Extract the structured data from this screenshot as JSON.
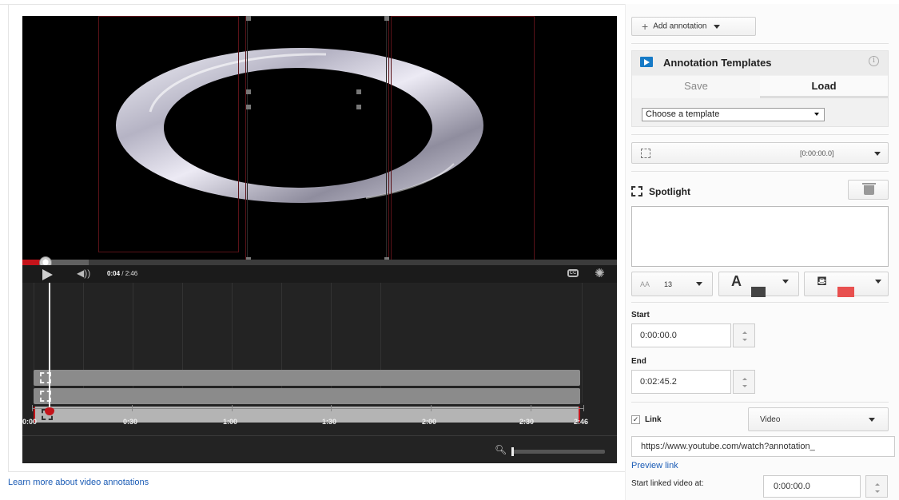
{
  "player": {
    "current_time": "0:04",
    "time_sep": " / ",
    "duration": "2:46",
    "cc_label": "CC",
    "icons": [
      "play-icon",
      "volume-icon",
      "cc-icon",
      "gear-icon",
      "zoom-icon"
    ],
    "progress_fraction": 0.024
  },
  "timeline": {
    "tick_labels": [
      "0:00",
      "0:30",
      "1:00",
      "1:30",
      "2:00",
      "2:30",
      "2:46"
    ],
    "tracks": 3,
    "selected_track": 2
  },
  "learn_more": "Learn more about video annotations",
  "sidebar": {
    "add_annotation": "Add annotation",
    "templates": {
      "title": "Annotation Templates",
      "info_glyph": "i",
      "tab_save": "Save",
      "tab_load": "Load",
      "choose": "Choose a template"
    },
    "annotation_select_time": "[0:00:00.0]",
    "spotlight": "Spotlight",
    "font_size": "13",
    "font_size_icon": "AA",
    "text_color": "#444444",
    "bg_color": "#e8504f",
    "start_label": "Start",
    "start_value": "0:00:00.0",
    "end_label": "End",
    "end_value": "0:02:45.2",
    "link_label": "Link",
    "link_checked": true,
    "link_type": "Video",
    "url": "https://www.youtube.com/watch?annotation_",
    "preview": "Preview link",
    "start_linked_label": "Start linked video at:",
    "start_linked_value": "0:00:00.0"
  },
  "colors": {
    "accent_red": "#c4131a",
    "link_blue": "#1a5bb5",
    "template_icon": "#167ac6"
  }
}
